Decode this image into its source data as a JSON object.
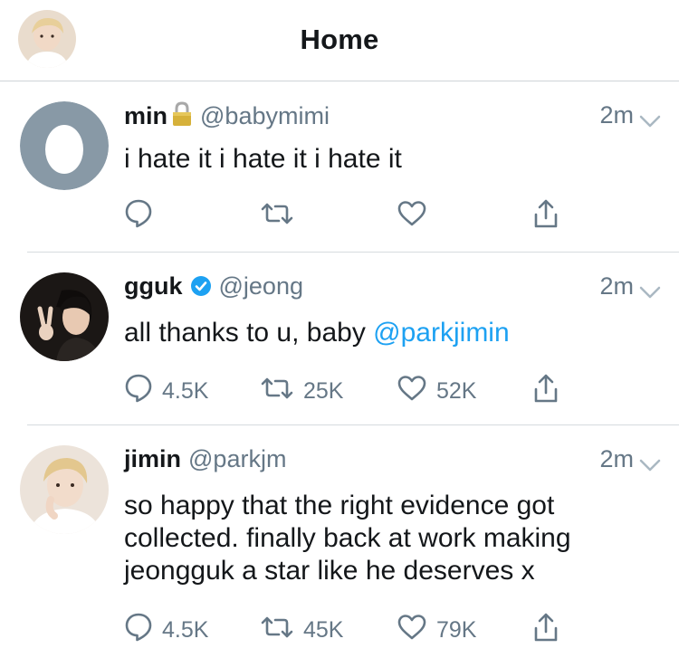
{
  "header": {
    "title": "Home"
  },
  "tweets": [
    {
      "name": "min",
      "locked": true,
      "verified": false,
      "handle": "@babymimi",
      "time": "2m",
      "text_parts": [
        "i hate it i hate it i hate it",
        ""
      ],
      "mention": "",
      "reply_count": "",
      "retweet_count": "",
      "like_count": ""
    },
    {
      "name": "gguk",
      "locked": false,
      "verified": true,
      "handle": "@jeong",
      "time": "2m",
      "text_parts": [
        "all thanks to u, baby ",
        ""
      ],
      "mention": "@parkjimin",
      "reply_count": "4.5K",
      "retweet_count": "25K",
      "like_count": "52K"
    },
    {
      "name": "jimin",
      "locked": false,
      "verified": false,
      "handle": "@parkjm",
      "time": "2m",
      "text_parts": [
        "so happy that the right evidence got",
        "collected. finally back at work making",
        "jeongguk a star like he deserves x"
      ],
      "mention": "",
      "reply_count": "4.5K",
      "retweet_count": "45K",
      "like_count": "79K"
    }
  ],
  "colors": {
    "muted": "#657786",
    "link": "#1da1f2",
    "verified": "#1da1f2",
    "egg_bg": "#8899a6",
    "lock": "#c9a227"
  },
  "icons": {
    "reply": "reply-icon",
    "retweet": "retweet-icon",
    "like": "like-icon",
    "share": "share-icon",
    "chevron": "chevron-down-icon",
    "lock": "lock-icon",
    "verified": "verified-badge-icon"
  }
}
